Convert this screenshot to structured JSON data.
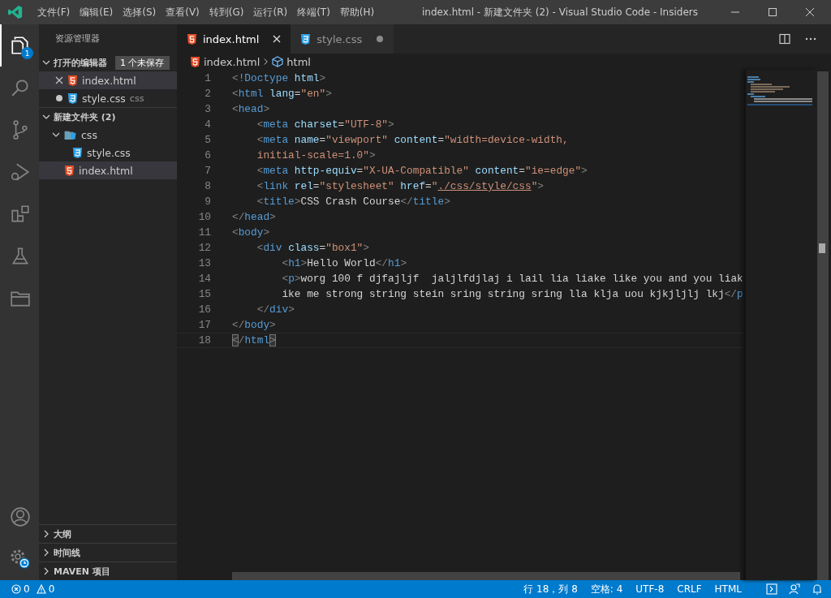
{
  "title_bar": {
    "menu": [
      "文件(F)",
      "编辑(E)",
      "选择(S)",
      "查看(V)",
      "转到(G)",
      "运行(R)",
      "终端(T)",
      "帮助(H)"
    ],
    "title": "index.html - 新建文件夹 (2) - Visual Studio Code - Insiders"
  },
  "activity_bar": {
    "items": [
      {
        "kind": "explorer",
        "selected": true,
        "badge": "1"
      },
      {
        "kind": "search",
        "selected": false
      },
      {
        "kind": "source-control",
        "selected": false
      },
      {
        "kind": "run",
        "selected": false
      },
      {
        "kind": "extensions",
        "selected": false
      },
      {
        "kind": "testing",
        "selected": false
      },
      {
        "kind": "folder",
        "selected": false
      }
    ],
    "bottom": [
      {
        "kind": "account"
      },
      {
        "kind": "settings"
      }
    ]
  },
  "sidebar": {
    "title": "资源管理器",
    "open_editors": {
      "label": "打开的编辑器",
      "expanded": true,
      "badge": "1 个未保存",
      "items": [
        {
          "name": "index.html",
          "kind": "html",
          "dirty": false,
          "selected": true
        },
        {
          "name": "style.css",
          "kind": "css",
          "dirty": true,
          "selected": false,
          "description": "css"
        }
      ]
    },
    "folder": {
      "label": "新建文件夹 (2)",
      "expanded": true,
      "tree": [
        {
          "name": "css",
          "kind": "folder",
          "expanded": true,
          "selected": false,
          "children": [
            {
              "name": "style.css",
              "kind": "css",
              "selected": false
            }
          ]
        },
        {
          "name": "index.html",
          "kind": "html",
          "selected": true
        }
      ]
    },
    "panels": [
      {
        "label": "大纲",
        "expanded": false
      },
      {
        "label": "时间线",
        "expanded": false
      },
      {
        "label": "MAVEN 项目",
        "expanded": false
      }
    ]
  },
  "editor": {
    "tabs": [
      {
        "name": "index.html",
        "kind": "html",
        "selected": true,
        "dirty": false
      },
      {
        "name": "style.css",
        "kind": "css",
        "selected": false,
        "dirty": true
      }
    ],
    "breadcrumb": [
      {
        "kind": "html",
        "text": "index.html"
      },
      {
        "kind": "element",
        "text": "html"
      }
    ],
    "lines": [
      {
        "number": "1",
        "current": false,
        "tokens": [
          {
            "kind": "d",
            "text": "<"
          },
          {
            "kind": "t",
            "text": "!Doctype"
          },
          {
            "kind": "a",
            "text": " html"
          },
          {
            "kind": "d",
            "text": ">"
          }
        ]
      },
      {
        "number": "2",
        "current": false,
        "tokens": [
          {
            "kind": "d",
            "text": "<"
          },
          {
            "kind": "t",
            "text": "html"
          },
          {
            "kind": "a",
            "text": " lang"
          },
          {
            "kind": "x",
            "text": "="
          },
          {
            "kind": "s",
            "text": "\"en\""
          },
          {
            "kind": "d",
            "text": ">"
          }
        ]
      },
      {
        "number": "3",
        "current": false,
        "tokens": [
          {
            "kind": "d",
            "text": "<"
          },
          {
            "kind": "t",
            "text": "head"
          },
          {
            "kind": "d",
            "text": ">"
          }
        ]
      },
      {
        "number": "4",
        "current": false,
        "tokens": [
          {
            "kind": "d",
            "text": "    <"
          },
          {
            "kind": "t",
            "text": "meta"
          },
          {
            "kind": "a",
            "text": " charset"
          },
          {
            "kind": "x",
            "text": "="
          },
          {
            "kind": "s",
            "text": "\"UTF-8\""
          },
          {
            "kind": "d",
            "text": ">"
          }
        ]
      },
      {
        "number": "5",
        "current": false,
        "tokens": [
          {
            "kind": "d",
            "text": "    <"
          },
          {
            "kind": "t",
            "text": "meta"
          },
          {
            "kind": "a",
            "text": " name"
          },
          {
            "kind": "x",
            "text": "="
          },
          {
            "kind": "s",
            "text": "\"viewport\""
          },
          {
            "kind": "a",
            "text": " content"
          },
          {
            "kind": "x",
            "text": "="
          },
          {
            "kind": "s",
            "text": "\"width=device-width,"
          }
        ]
      },
      {
        "number": "6",
        "current": false,
        "tokens": [
          {
            "kind": "s",
            "text": "    initial-scale=1.0\""
          },
          {
            "kind": "d",
            "text": ">"
          }
        ]
      },
      {
        "number": "7",
        "current": false,
        "tokens": [
          {
            "kind": "d",
            "text": "    <"
          },
          {
            "kind": "t",
            "text": "meta"
          },
          {
            "kind": "a",
            "text": " http-equiv"
          },
          {
            "kind": "x",
            "text": "="
          },
          {
            "kind": "s",
            "text": "\"X-UA-Compatible\""
          },
          {
            "kind": "a",
            "text": " content"
          },
          {
            "kind": "x",
            "text": "="
          },
          {
            "kind": "s",
            "text": "\"ie=edge\""
          },
          {
            "kind": "d",
            "text": ">"
          }
        ]
      },
      {
        "number": "8",
        "current": false,
        "tokens": [
          {
            "kind": "d",
            "text": "    <"
          },
          {
            "kind": "t",
            "text": "link"
          },
          {
            "kind": "a",
            "text": " rel"
          },
          {
            "kind": "x",
            "text": "="
          },
          {
            "kind": "s",
            "text": "\"stylesheet\""
          },
          {
            "kind": "a",
            "text": " href"
          },
          {
            "kind": "x",
            "text": "="
          },
          {
            "kind": "s",
            "text": "\""
          },
          {
            "kind": "l",
            "text": "./css/style/css"
          },
          {
            "kind": "s",
            "text": "\""
          },
          {
            "kind": "d",
            "text": ">"
          }
        ]
      },
      {
        "number": "9",
        "current": false,
        "tokens": [
          {
            "kind": "d",
            "text": "    <"
          },
          {
            "kind": "t",
            "text": "title"
          },
          {
            "kind": "d",
            "text": ">"
          },
          {
            "kind": "x",
            "text": "CSS Crash Course"
          },
          {
            "kind": "d",
            "text": "</"
          },
          {
            "kind": "t",
            "text": "title"
          },
          {
            "kind": "d",
            "text": ">"
          }
        ]
      },
      {
        "number": "10",
        "current": false,
        "tokens": [
          {
            "kind": "d",
            "text": "</"
          },
          {
            "kind": "t",
            "text": "head"
          },
          {
            "kind": "d",
            "text": ">"
          }
        ]
      },
      {
        "number": "11",
        "current": false,
        "tokens": [
          {
            "kind": "d",
            "text": "<"
          },
          {
            "kind": "t",
            "text": "body"
          },
          {
            "kind": "d",
            "text": ">"
          }
        ]
      },
      {
        "number": "12",
        "current": false,
        "tokens": [
          {
            "kind": "d",
            "text": "    <"
          },
          {
            "kind": "t",
            "text": "div"
          },
          {
            "kind": "a",
            "text": " class"
          },
          {
            "kind": "x",
            "text": "="
          },
          {
            "kind": "s",
            "text": "\"box1\""
          },
          {
            "kind": "d",
            "text": ">"
          }
        ]
      },
      {
        "number": "13",
        "current": false,
        "tokens": [
          {
            "kind": "d",
            "text": "        <"
          },
          {
            "kind": "t",
            "text": "h1"
          },
          {
            "kind": "d",
            "text": ">"
          },
          {
            "kind": "x",
            "text": "Hello World"
          },
          {
            "kind": "d",
            "text": "</"
          },
          {
            "kind": "t",
            "text": "h1"
          },
          {
            "kind": "d",
            "text": ">"
          }
        ]
      },
      {
        "number": "14",
        "current": false,
        "tokens": [
          {
            "kind": "d",
            "text": "        <"
          },
          {
            "kind": "t",
            "text": "p"
          },
          {
            "kind": "d",
            "text": ">"
          },
          {
            "kind": "x",
            "text": "worg 100 f djfajljf  jaljlfdjlaj i lail lia liake like you and you liak"
          }
        ]
      },
      {
        "number": "15",
        "current": false,
        "tokens": [
          {
            "kind": "x",
            "text": "        ike me strong string stein sring string sring lla klja uou kjkjljlj lkj"
          },
          {
            "kind": "d",
            "text": "</"
          },
          {
            "kind": "t",
            "text": "p"
          }
        ]
      },
      {
        "number": "16",
        "current": false,
        "tokens": [
          {
            "kind": "d",
            "text": "    </"
          },
          {
            "kind": "t",
            "text": "div"
          },
          {
            "kind": "d",
            "text": ">"
          }
        ]
      },
      {
        "number": "17",
        "current": false,
        "tokens": [
          {
            "kind": "d",
            "text": "</"
          },
          {
            "kind": "t",
            "text": "body"
          },
          {
            "kind": "d",
            "text": ">"
          }
        ]
      },
      {
        "number": "18",
        "current": true,
        "tokens": [
          {
            "kind": "m",
            "text": "<"
          },
          {
            "kind": "d",
            "text": "/"
          },
          {
            "kind": "t",
            "text": "html"
          },
          {
            "kind": "m",
            "text": ">"
          }
        ]
      }
    ]
  },
  "status_bar": {
    "errors": "0",
    "warnings": "0",
    "items": [
      "行 18，列 8",
      "空格: 4",
      "UTF-8",
      "CRLF",
      "HTML"
    ]
  }
}
